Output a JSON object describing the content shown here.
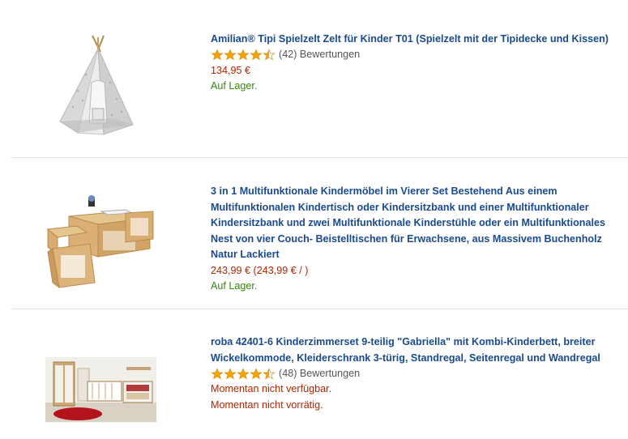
{
  "products": [
    {
      "title": "Amilian® Tipi Spielzelt Zelt für Kinder T01 (Spielzelt mit der Tipidecke und Kissen)",
      "image": "teepee-tent-image",
      "rating": 4.5,
      "review_count": "(42)",
      "review_label": "Bewertungen",
      "price": "134,95 €",
      "availability": "Auf Lager."
    },
    {
      "title": "3 in 1 Multifunktionale Kindermöbel im Vierer Set Bestehend Aus einem Multifunktionalen Kindertisch oder Kindersitzbank und einer Multifunktionaler Kindersitzbank und zwei Multifunktionale Kinderstühle oder ein Multifunktionales Nest von vier Couch- Beistelltischen für Erwachsene, aus Massivem Buchenholz Natur Lackiert",
      "image": "wooden-furniture-set-image",
      "price": "243,99 € (243,99 € / )",
      "availability": "Auf Lager."
    },
    {
      "title": "roba 42401-6 Kinderzimmerset 9-teilig \"Gabriella\" mit Kombi-Kinderbett, breiter Wickelkommode, Kleiderschrank 3-türig, Standregal, Seitenregal und Wandregal",
      "image": "nursery-room-image",
      "rating": 4.5,
      "review_count": "(48)",
      "review_label": "Bewertungen",
      "availability_1": "Momentan nicht verfügbar.",
      "availability_2": "Momentan nicht vorrätig."
    }
  ],
  "colors": {
    "link": "#1a4b8e",
    "price": "#b12704",
    "in_stock": "#34880a",
    "star": "#f4a300"
  }
}
